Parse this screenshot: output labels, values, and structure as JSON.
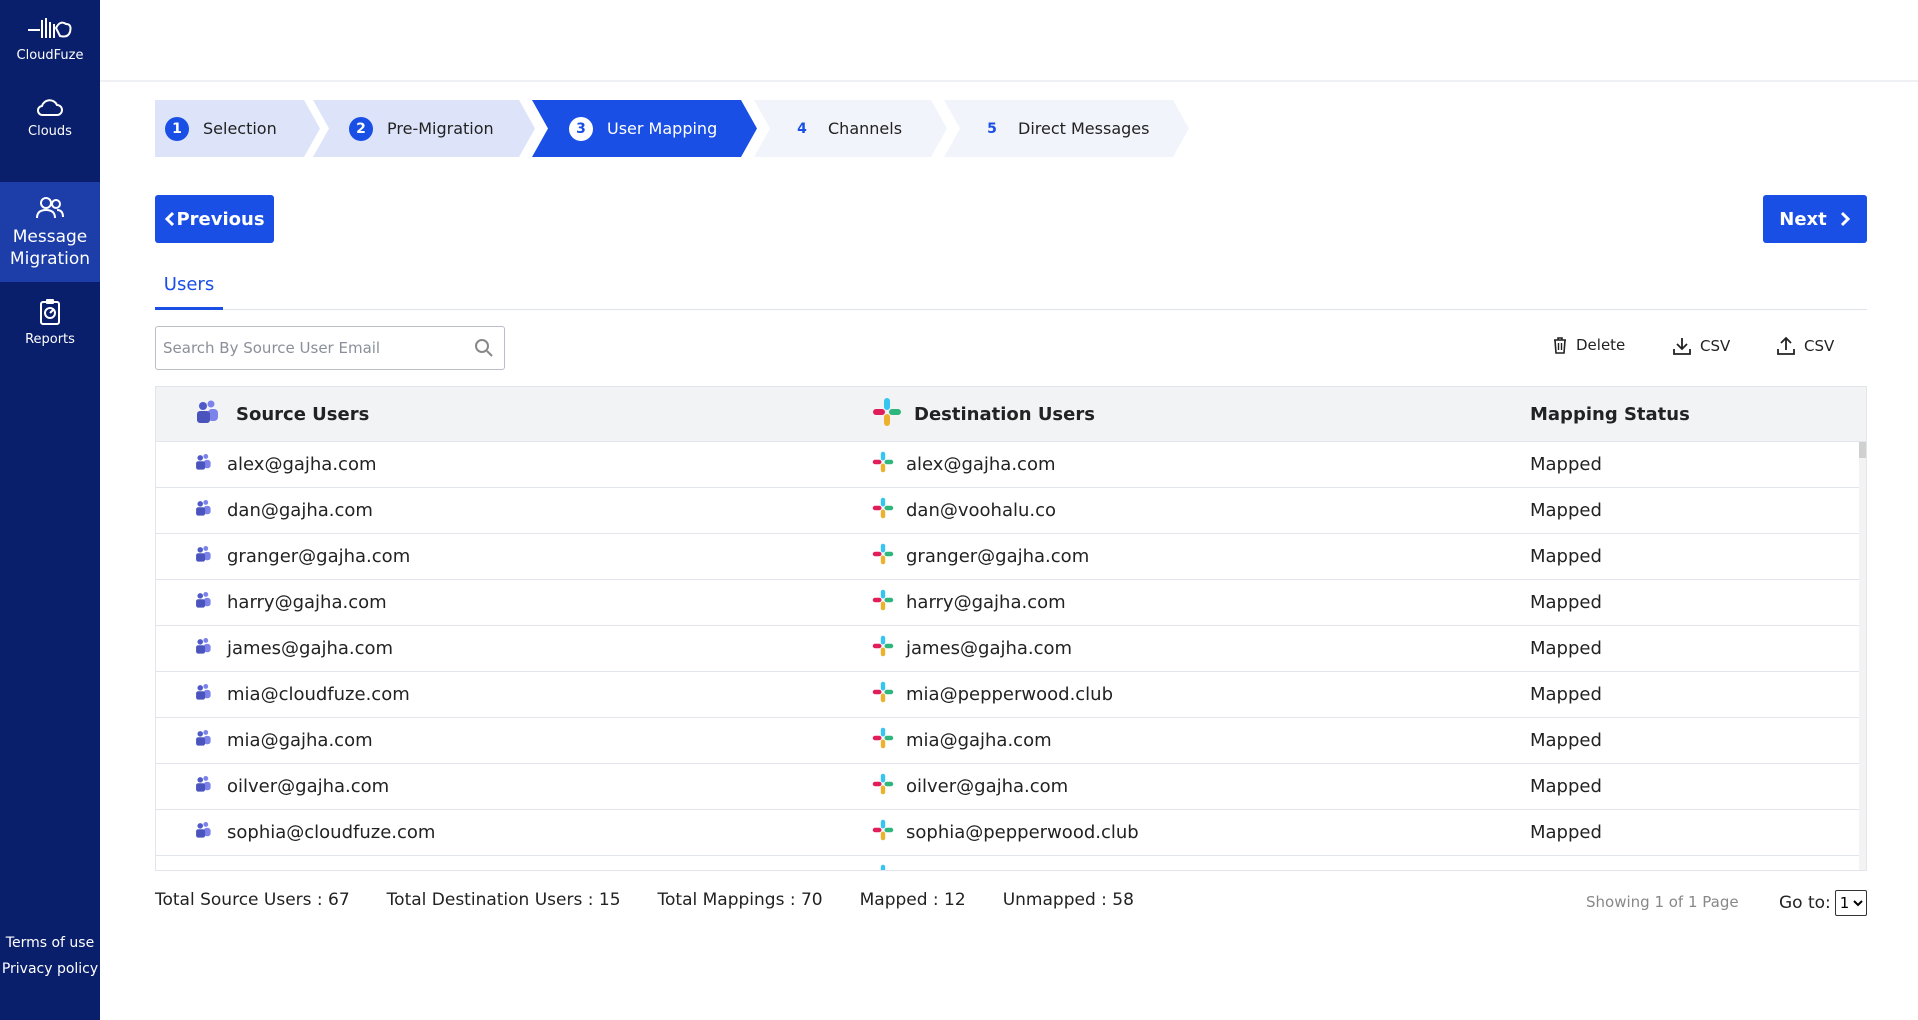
{
  "brand": {
    "name": "CloudFuze"
  },
  "sidebar": {
    "items": [
      {
        "label": "Clouds"
      },
      {
        "label": "Message Migration"
      },
      {
        "label": "Reports"
      }
    ],
    "links": {
      "terms": "Terms of use",
      "privacy": "Privacy policy"
    }
  },
  "stepper": {
    "steps": [
      {
        "num": "1",
        "label": "Selection",
        "state": "done"
      },
      {
        "num": "2",
        "label": "Pre-Migration",
        "state": "done"
      },
      {
        "num": "3",
        "label": "User Mapping",
        "state": "active"
      },
      {
        "num": "4",
        "label": "Channels",
        "state": "todo"
      },
      {
        "num": "5",
        "label": "Direct Messages",
        "state": "todo"
      }
    ]
  },
  "buttons": {
    "previous": "Previous",
    "next": "Next"
  },
  "tabs": {
    "users": "Users"
  },
  "search": {
    "placeholder": "Search By Source User Email"
  },
  "actions": {
    "delete": "Delete",
    "download_csv": "CSV",
    "upload_csv": "CSV"
  },
  "table": {
    "headers": {
      "source": "Source Users",
      "destination": "Destination Users",
      "status": "Mapping Status"
    },
    "rows": [
      {
        "source": "alex@gajha.com",
        "destination": "alex@gajha.com",
        "status": "Mapped"
      },
      {
        "source": "dan@gajha.com",
        "destination": "dan@voohalu.co",
        "status": "Mapped"
      },
      {
        "source": "granger@gajha.com",
        "destination": "granger@gajha.com",
        "status": "Mapped"
      },
      {
        "source": "harry@gajha.com",
        "destination": "harry@gajha.com",
        "status": "Mapped"
      },
      {
        "source": "james@gajha.com",
        "destination": "james@gajha.com",
        "status": "Mapped"
      },
      {
        "source": "mia@cloudfuze.com",
        "destination": "mia@pepperwood.club",
        "status": "Mapped"
      },
      {
        "source": "mia@gajha.com",
        "destination": "mia@gajha.com",
        "status": "Mapped"
      },
      {
        "source": "oilver@gajha.com",
        "destination": "oilver@gajha.com",
        "status": "Mapped"
      },
      {
        "source": "sophia@cloudfuze.com",
        "destination": "sophia@pepperwood.club",
        "status": "Mapped"
      }
    ]
  },
  "footer": {
    "total_source": "Total Source Users : 67",
    "total_destination": "Total Destination Users : 15",
    "total_mappings": "Total Mappings : 70",
    "mapped": "Mapped : 12",
    "unmapped": "Unmapped : 58",
    "showing": "Showing 1 of 1 Page",
    "goto_label": "Go to:",
    "goto_value": "1"
  },
  "colors": {
    "sidebar": "#0a1f6b",
    "accent": "#1a4fe6",
    "active_nav": "#1d3da8"
  }
}
